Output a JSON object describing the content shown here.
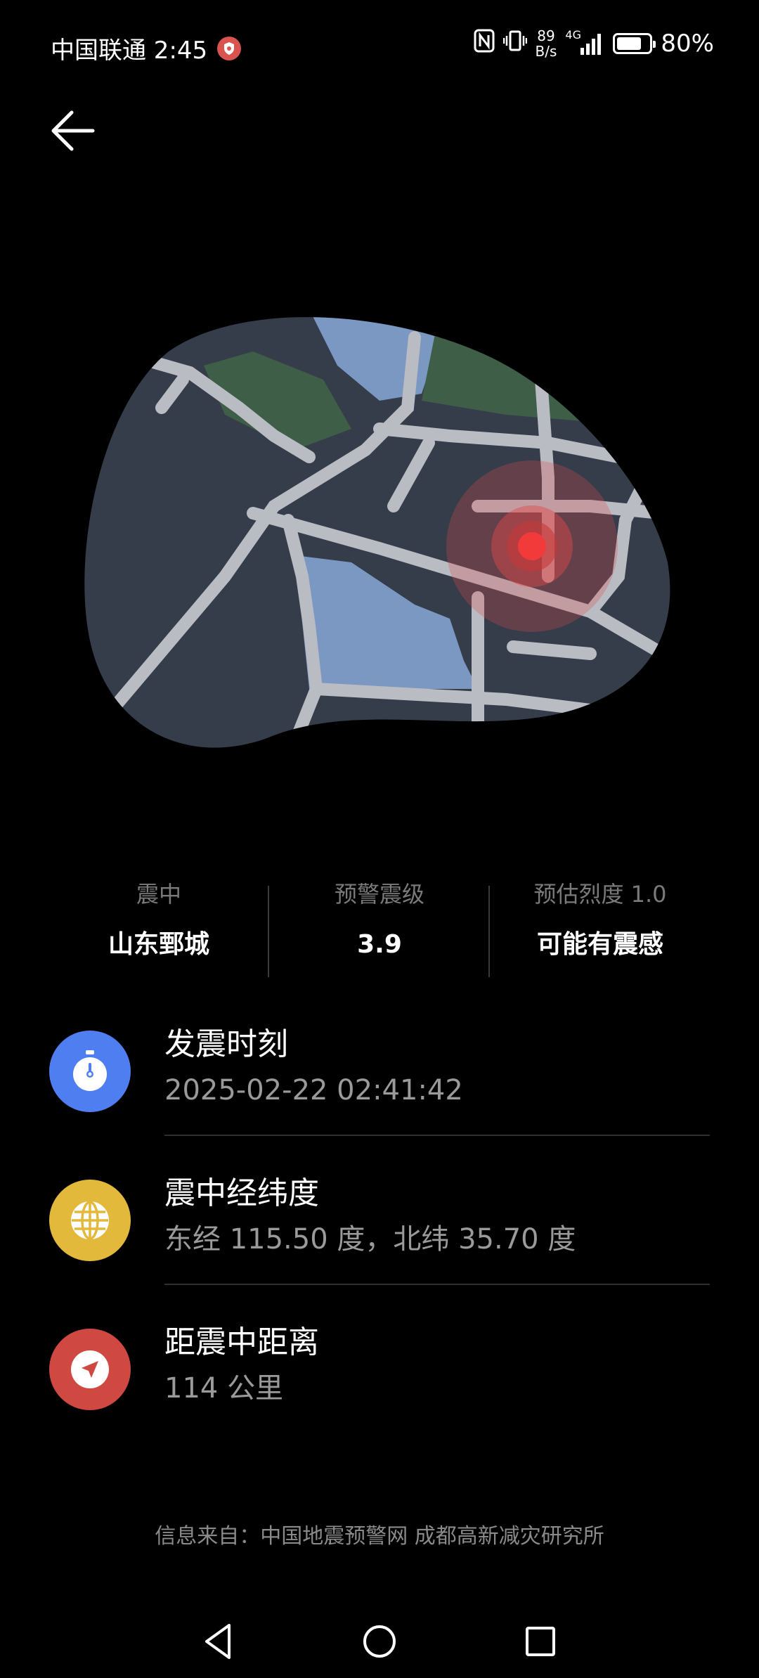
{
  "status_bar": {
    "carrier_time": "中国联通 2:45",
    "net_speed_value": "89",
    "net_speed_unit": "B/s",
    "network_type": "4G",
    "battery_percent": "80%",
    "battery_level": 0.8
  },
  "nav": {
    "back_icon": "arrow-left-icon"
  },
  "stats": [
    {
      "label": "震中",
      "value": "山东鄄城"
    },
    {
      "label": "预警震级",
      "value": "3.9"
    },
    {
      "label": "预估烈度 1.0",
      "value": "可能有震感"
    }
  ],
  "info": [
    {
      "title": "发震时刻",
      "sub": "2025-02-22 02:41:42",
      "icon": "stopwatch-icon",
      "color": "#4f7ef0"
    },
    {
      "title": "震中经纬度",
      "sub": "东经 115.50 度，北纬 35.70 度",
      "icon": "globe-icon",
      "color": "#e3b93c"
    },
    {
      "title": "距震中距离",
      "sub": "114 公里",
      "icon": "navigation-icon",
      "color": "#cf4841"
    }
  ],
  "source": "信息来自：中国地震预警网 成都高新减灾研究所",
  "system_nav": {
    "back": "nav-back-icon",
    "home": "nav-home-icon",
    "recents": "nav-recents-icon"
  }
}
